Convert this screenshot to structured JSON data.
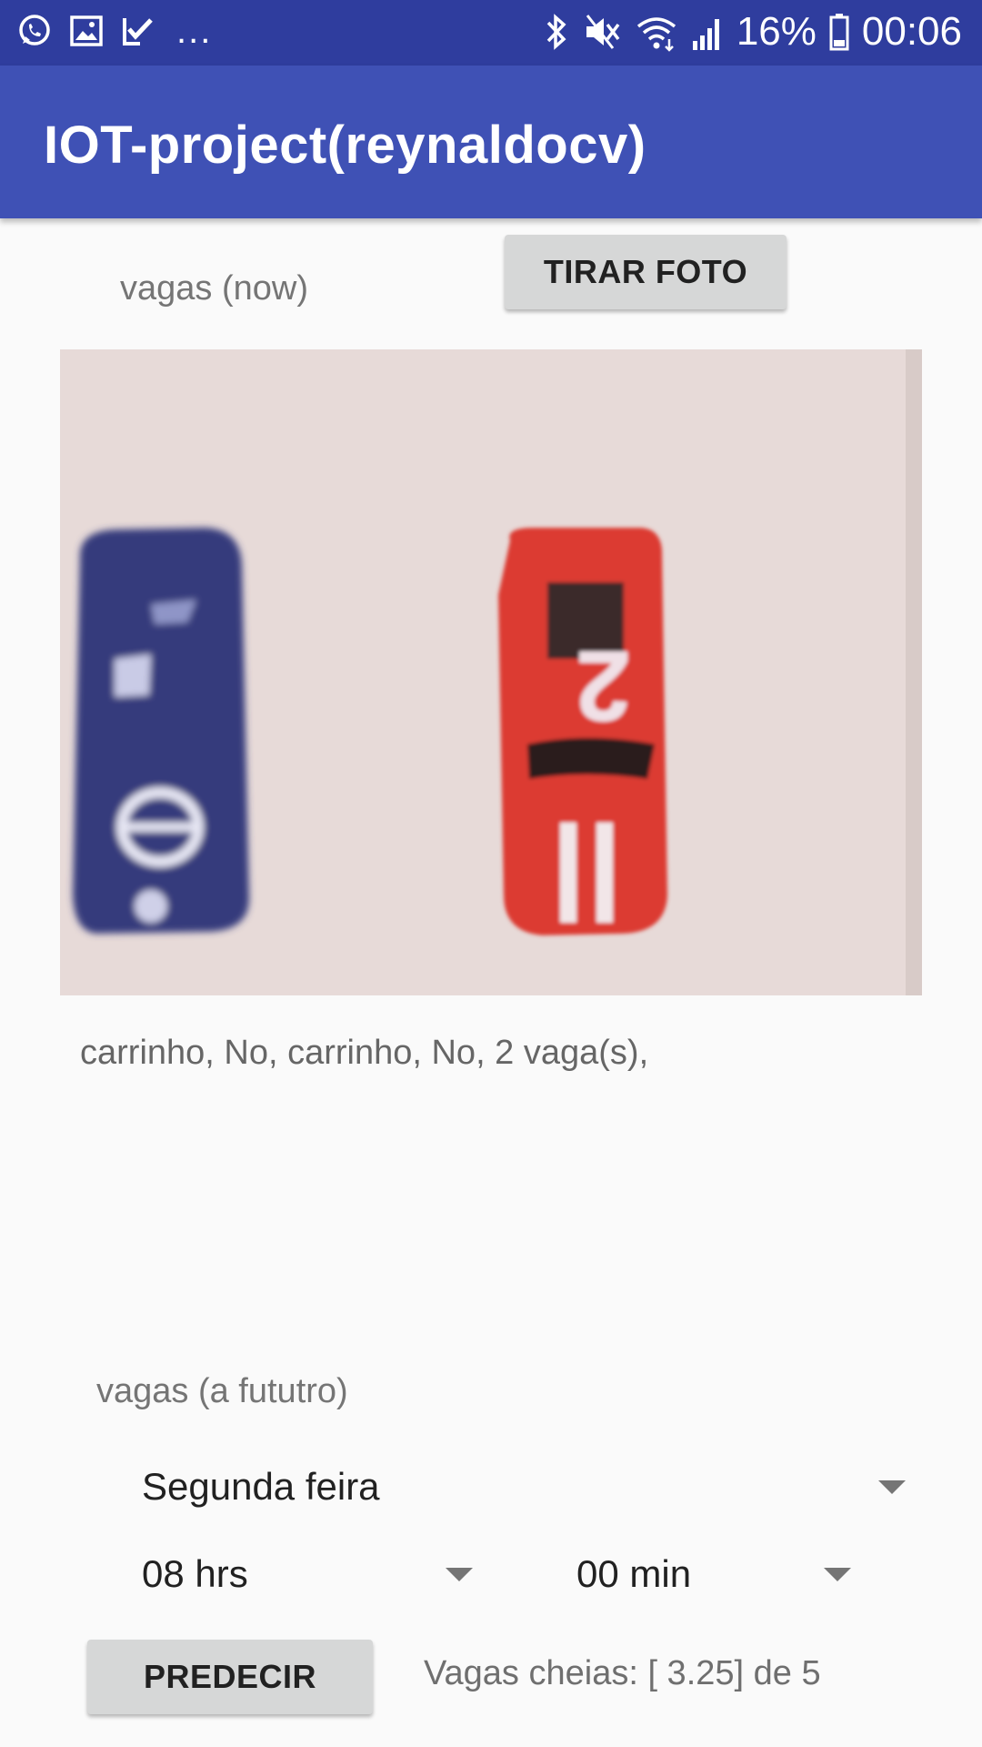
{
  "status_bar": {
    "left_icons": [
      "whatsapp-icon",
      "gallery-icon",
      "check-icon"
    ],
    "overflow": "...",
    "right_icons": [
      "bluetooth-icon",
      "mute-icon",
      "wifi-icon",
      "signal-icon"
    ],
    "battery_percent": "16%",
    "time": "00:06"
  },
  "app_bar": {
    "title": "IOT-project(reynaldocv)"
  },
  "now_section": {
    "label": "vagas (now)",
    "photo_button": "TIRAR FOTO",
    "detection_result": "carrinho, No, carrinho, No, 2 vaga(s),"
  },
  "future_section": {
    "label": "vagas (a fututro)",
    "day_selected": "Segunda feira",
    "hour_selected": "08 hrs",
    "minute_selected": "00 min",
    "predict_button": "PREDECIR",
    "prediction_text": "Vagas cheias: [ 3.25] de 5"
  },
  "colors": {
    "status_bar": "#2f3d9e",
    "app_bar": "#3f51b5",
    "background": "#fafafa",
    "button": "#d6d7d7"
  }
}
